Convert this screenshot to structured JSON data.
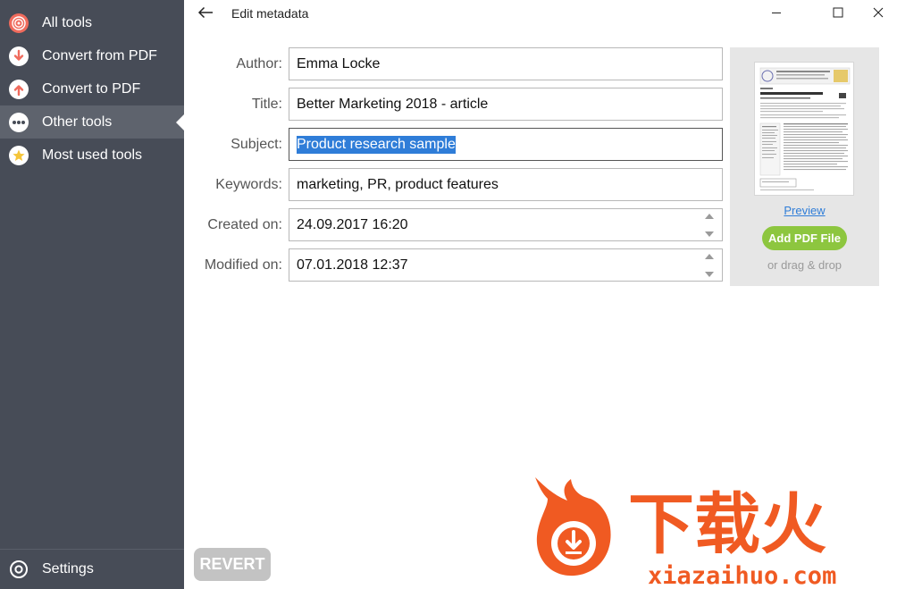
{
  "sidebar": {
    "items": [
      {
        "label": "All tools",
        "icon": "target-icon",
        "color": "#f06b5d"
      },
      {
        "label": "Convert from PDF",
        "icon": "arrow-down-icon",
        "color": "#f06b5d"
      },
      {
        "label": "Convert to PDF",
        "icon": "arrow-up-icon",
        "color": "#f06b5d"
      },
      {
        "label": "Other tools",
        "icon": "more-dots-icon",
        "color": "#ffffff"
      },
      {
        "label": "Most used tools",
        "icon": "star-icon",
        "color": "#f5d04c"
      }
    ],
    "active_index": 3,
    "settings_label": "Settings",
    "settings_icon": "gear-icon"
  },
  "header": {
    "title": "Edit metadata",
    "back_icon": "back-arrow-icon",
    "window_controls": [
      "minimize-icon",
      "maximize-icon",
      "close-icon"
    ]
  },
  "form": {
    "author_label": "Author:",
    "author_value": "Emma Locke",
    "title_label": "Title:",
    "title_value": "Better Marketing 2018 - article",
    "subject_label": "Subject:",
    "subject_value": "Product research sample",
    "keywords_label": "Keywords:",
    "keywords_value": "marketing, PR, product features",
    "created_label": "Created on:",
    "created_value": "24.09.2017 16:20",
    "modified_label": "Modified on:",
    "modified_value": "07.01.2018 12:37"
  },
  "preview": {
    "preview_link": "Preview",
    "add_button": "Add PDF File",
    "drag_text": "or drag & drop"
  },
  "footer": {
    "revert_label": "REVERT"
  },
  "watermark": {
    "text_cn": "下载火",
    "text_url": "xiazaihuo.com"
  },
  "colors": {
    "sidebar_bg": "#474c57",
    "sidebar_active": "#5e636d",
    "selection": "#2f7dd8",
    "add_button": "#8dc63f",
    "revert_button": "#c3c3c3",
    "watermark_orange": "#f05a22"
  }
}
